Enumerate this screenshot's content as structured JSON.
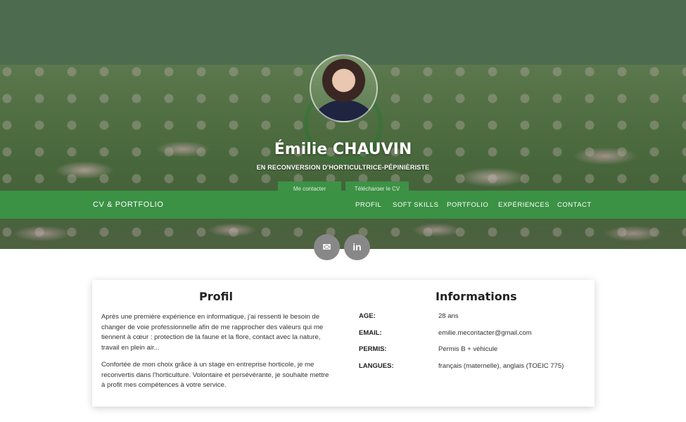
{
  "hero": {
    "name": "Émilie CHAUVIN",
    "subtitle": "EN RECONVERSION D'HORTICULTRICE-PÉPINIÈRISTE",
    "buttons": {
      "contact": "Me contacter",
      "cv": "Télécharger le CV"
    }
  },
  "navbar": {
    "brand": "CV & PORTFOLIO",
    "links": [
      "PROFIL",
      "SOFT SKILLS",
      "PORTFOLIO",
      "EXPÉRIENCES",
      "CONTACT"
    ],
    "color": "#3b9144"
  },
  "social": {
    "email_icon": "envelope-icon",
    "linkedin_icon": "linkedin-icon",
    "email_glyph": "✉",
    "linkedin_glyph": "in"
  },
  "profil": {
    "title": "Profil",
    "paragraphs": [
      "Après une première expérience en informatique, j'ai ressenti le besoin de changer de voie professionnelle afin de me rapprocher des valeurs qui me tiennent à cœur : protection de la faune et la flore, contact avec la nature, travail en plein air...",
      "Confortée de mon choix grâce à un stage en entreprise horticole, je me reconvertis dans l'horticulture. Volontaire et persévérante, je souhaite mettre à profit mes compétences à votre service."
    ]
  },
  "informations": {
    "title": "Informations",
    "rows": [
      {
        "label": "AGE:",
        "value": "28 ans"
      },
      {
        "label": "EMAIL:",
        "value": "emilie.mecontacter@gmail.com"
      },
      {
        "label": "PERMIS:",
        "value": "Permis B + véhicule"
      },
      {
        "label": "LANGUES:",
        "value": "français (maternelle), anglais (TOEIC 775)"
      }
    ]
  }
}
